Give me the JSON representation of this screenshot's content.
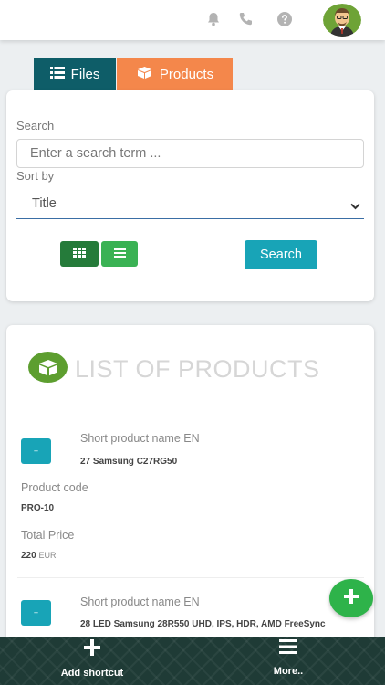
{
  "tabs": {
    "files_label": "Files",
    "products_label": "Products"
  },
  "search": {
    "search_label": "Search",
    "placeholder": "Enter a search term ...",
    "sort_label": "Sort by",
    "sort_value": "Title",
    "search_button": "Search"
  },
  "list": {
    "title": "LIST OF PRODUCTS",
    "items": [
      {
        "plus": "+",
        "name_label": "Short product name EN",
        "name_value": "27 Samsung C27RG50",
        "code_label": "Product code",
        "code_value": "PRO-10",
        "price_label": "Total Price",
        "price_value": "220",
        "price_unit": "EUR"
      },
      {
        "plus": "+",
        "name_label": "Short product name EN",
        "name_value": "28 LED Samsung 28R550 UHD, IPS, HDR, AMD FreeSync"
      }
    ]
  },
  "bottombar": {
    "add_shortcut": "Add shortcut",
    "more": "More.."
  },
  "colors": {
    "tab_files": "#0e5d68",
    "tab_products": "#f4874b",
    "search_button": "#18a4b7",
    "grid_button": "#257b3a",
    "list_button": "#3ab254",
    "fab": "#2eb34a"
  }
}
